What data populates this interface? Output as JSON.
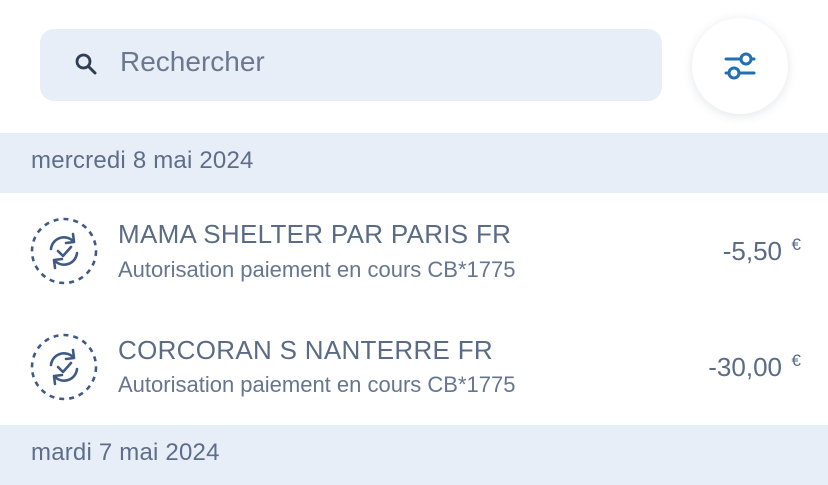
{
  "search": {
    "placeholder": "Rechercher"
  },
  "filter": {
    "icon": "sliders-icon"
  },
  "groups": [
    {
      "date": "mercredi 8 mai 2024",
      "transactions": [
        {
          "title": "MAMA SHELTER PAR PARIS FR",
          "subtitle": "Autorisation paiement en cours CB*1775",
          "amount": "-5,50",
          "currency": "€",
          "icon": "pending-sync-icon"
        },
        {
          "title": "CORCORAN S NANTERRE FR",
          "subtitle": "Autorisation paiement en cours CB*1775",
          "amount": "-30,00",
          "currency": "€",
          "icon": "pending-sync-icon"
        }
      ]
    },
    {
      "date": "mardi 7 mai 2024",
      "transactions": []
    }
  ],
  "colors": {
    "accent": "#1f6fb5",
    "header_bg": "#e8eef8",
    "text": "#5a6b86"
  }
}
